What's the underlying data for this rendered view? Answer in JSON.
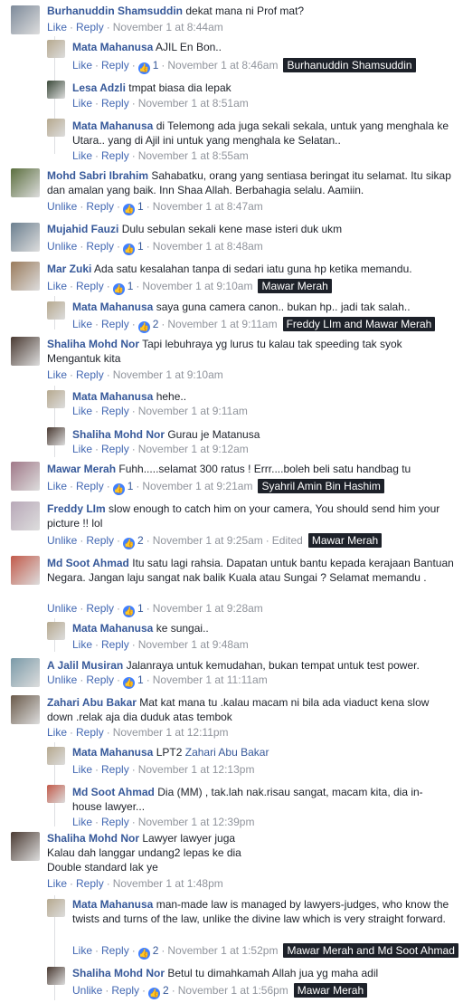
{
  "actions": {
    "like": "Like",
    "unlike": "Unlike",
    "reply": "Reply",
    "edited": "Edited"
  },
  "comments": [
    {
      "name": "Burhanuddin Shamsuddin",
      "text": "dekat mana ni Prof mat?",
      "time": "November 1 at 8:44am",
      "action": "Like"
    },
    {
      "name": "Mata Mahanusa",
      "text": "AJIL En Bon..",
      "time": "November 1 at 8:46am",
      "action": "Like",
      "likes": "1",
      "tag": "Burhanuddin Shamsuddin"
    },
    {
      "name": "Lesa Adzli",
      "text": "tmpat biasa dia lepak",
      "time": "November 1 at 8:51am",
      "action": "Like"
    },
    {
      "name": "Mata Mahanusa",
      "text": "di Telemong ada juga sekali sekala, untuk yang menghala ke Utara.. yang di Ajil ini untuk yang menghala ke Selatan..",
      "time": "November 1 at 8:55am",
      "action": "Like"
    },
    {
      "name": "Mohd Sabri Ibrahim",
      "text": "Sahabatku, orang yang sentiasa beringat itu selamat. Itu sikap dan amalan yang baik. Inn Shaa Allah. Berbahagia selalu. Aamiin.",
      "time": "November 1 at 8:47am",
      "action": "Unlike",
      "likes": "1"
    },
    {
      "name": "Mujahid Fauzi",
      "text": "Dulu sebulan sekali kene mase isteri duk ukm",
      "time": "November 1 at 8:48am",
      "action": "Unlike",
      "likes": "1"
    },
    {
      "name": "Mar Zuki",
      "text": "Ada satu kesalahan tanpa di sedari iatu guna hp ketika memandu.",
      "time": "November 1 at 9:10am",
      "action": "Like",
      "likes": "1",
      "tag": "Mawar Merah"
    },
    {
      "name": "Mata Mahanusa",
      "text": "saya guna camera canon.. bukan hp.. jadi tak salah..",
      "time": "November 1 at 9:11am",
      "action": "Like",
      "likes": "2",
      "tag": "Freddy LIm and Mawar Merah"
    },
    {
      "name": "Shaliha Mohd Nor",
      "text": "Tapi lebuhraya yg lurus tu kalau tak speeding tak syok Mengantuk kita",
      "time": "November 1 at 9:10am",
      "action": "Like"
    },
    {
      "name": "Mata Mahanusa",
      "text": "hehe..",
      "time": "November 1 at 9:11am",
      "action": "Like"
    },
    {
      "name": "Shaliha Mohd Nor",
      "text": "Gurau je Matanusa",
      "time": "November 1 at 9:12am",
      "action": "Like"
    },
    {
      "name": "Mawar Merah",
      "text": "Fuhh.....selamat 300 ratus ! Errr....boleh beli satu handbag tu",
      "time": "November 1 at 9:21am",
      "action": "Like",
      "likes": "1",
      "tag": "Syahril Amin Bin Hashim"
    },
    {
      "name": "Freddy LIm",
      "text": "slow enough to catch him on your camera, You should send him your picture !! lol",
      "time": "November 1 at 9:25am",
      "action": "Unlike",
      "likes": "2",
      "edited": true,
      "tag": "Mawar Merah"
    },
    {
      "name": "Md Soot Ahmad",
      "text": "Itu satu lagi rahsia. Dapatan untuk bantu kepada kerajaan Bantuan Negara. Jangan laju sangat nak balik Kuala atau Sungai ? Selamat memandu .",
      "time": "November 1 at 9:28am",
      "action": "Unlike",
      "likes": "1"
    },
    {
      "name": "Mata Mahanusa",
      "text": "ke sungai..",
      "time": "November 1 at 9:48am",
      "action": "Like"
    },
    {
      "name": "A Jalil Musiran",
      "text": "Jalanraya untuk kemudahan, bukan tempat untuk test power.",
      "time": "November 1 at 11:11am",
      "action": "Unlike",
      "likes": "1"
    },
    {
      "name": "Zahari Abu Bakar",
      "text": "Mat kat mana tu .kalau macam ni bila ada viaduct kena slow down .relak aja dia duduk atas tembok",
      "time": "November 1 at 12:11pm",
      "action": "Like"
    },
    {
      "name": "Mata Mahanusa",
      "text": "LPT2",
      "mention": "Zahari Abu Bakar",
      "time": "November 1 at 12:13pm",
      "action": "Like"
    },
    {
      "name": "Md Soot Ahmad",
      "text": "Dia (MM) , tak.lah nak.risau sangat, macam kita, dia in-house lawyer...",
      "time": "November 1 at 12:39pm",
      "action": "Like"
    },
    {
      "name": "Shaliha Mohd Nor",
      "text": "Lawyer lawyer juga\nKalau dah langgar undang2 lepas ke dia\nDouble standard lak ye",
      "time": "November 1 at 1:48pm",
      "action": "Like"
    },
    {
      "name": "Mata Mahanusa",
      "text": "man-made law is managed by lawyers-judges, who know the twists and turns of the law, unlike the divine law which is very straight forward.",
      "time": "November 1 at 1:52pm",
      "action": "Like",
      "likes": "2",
      "tag": "Mawar Merah and Md Soot Ahmad"
    },
    {
      "name": "Shaliha Mohd Nor",
      "text": "Betul tu dimahkamah Allah jua yg maha adil",
      "time": "November 1 at 1:56pm",
      "action": "Unlike",
      "likes": "2",
      "tag": "Mawar Merah"
    }
  ],
  "colors": {
    "link": "#365899",
    "meta": "#90949c",
    "tagbg": "#1d2129",
    "likeblue": "#4080ff"
  }
}
